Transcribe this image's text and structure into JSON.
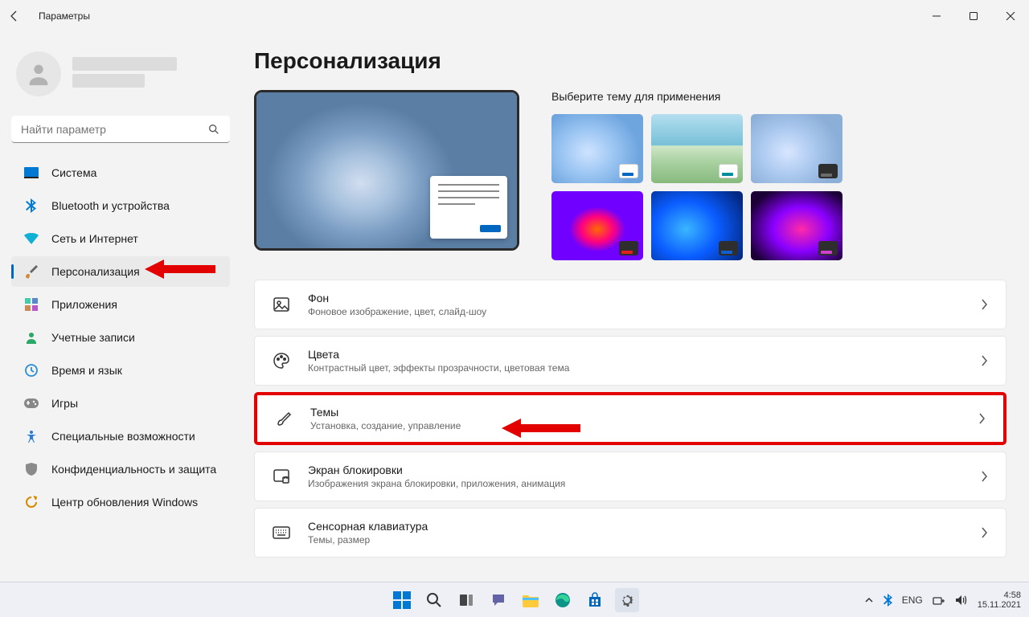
{
  "window": {
    "title": "Параметры"
  },
  "search": {
    "placeholder": "Найти параметр"
  },
  "sidebar": {
    "items": [
      {
        "label": "Система",
        "icon": "display"
      },
      {
        "label": "Bluetooth и устройства",
        "icon": "bluetooth"
      },
      {
        "label": "Сеть и Интернет",
        "icon": "wifi"
      },
      {
        "label": "Персонализация",
        "icon": "brush",
        "active": true
      },
      {
        "label": "Приложения",
        "icon": "apps"
      },
      {
        "label": "Учетные записи",
        "icon": "account"
      },
      {
        "label": "Время и язык",
        "icon": "time"
      },
      {
        "label": "Игры",
        "icon": "games"
      },
      {
        "label": "Специальные возможности",
        "icon": "accessibility"
      },
      {
        "label": "Конфиденциальность и защита",
        "icon": "shield"
      },
      {
        "label": "Центр обновления Windows",
        "icon": "update"
      }
    ]
  },
  "page": {
    "title": "Персонализация",
    "theme_header": "Выберите тему для применения"
  },
  "cards": [
    {
      "title": "Фон",
      "sub": "Фоновое изображение, цвет, слайд-шоу",
      "icon": "image"
    },
    {
      "title": "Цвета",
      "sub": "Контрастный цвет, эффекты прозрачности, цветовая тема",
      "icon": "palette"
    },
    {
      "title": "Темы",
      "sub": "Установка, создание, управление",
      "icon": "pen",
      "highlight": true
    },
    {
      "title": "Экран блокировки",
      "sub": "Изображения экрана блокировки, приложения, анимация",
      "icon": "lock"
    },
    {
      "title": "Сенсорная клавиатура",
      "sub": "Темы, размер",
      "icon": "keyboard"
    }
  ],
  "tray": {
    "lang": "ENG",
    "time": "4:58",
    "date": "15.11.2021"
  }
}
